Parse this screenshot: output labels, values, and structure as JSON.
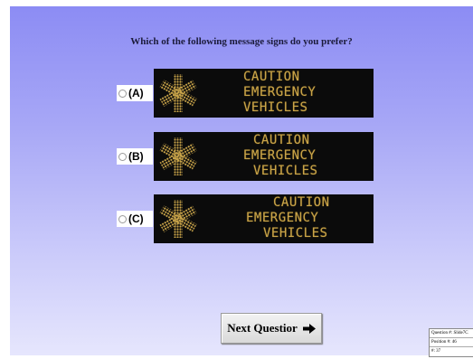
{
  "question": "Which of the following message signs do you prefer?",
  "options": [
    {
      "label": "(A)",
      "lines": [
        "CAUTION",
        "EMERGENCY",
        "VEHICLES"
      ]
    },
    {
      "label": "(B)",
      "lines": [
        "CAUTION",
        "EMERGENCY",
        "VEHICLES"
      ]
    },
    {
      "label": "(C)",
      "lines": [
        "CAUTION",
        "EMERGENCY",
        "VEHICLES"
      ]
    }
  ],
  "sign_text_color": "#c9a449",
  "sign_icon": "star-of-life-icon",
  "next_button": {
    "label": "Next Questior",
    "icon": "arrow-right-icon"
  },
  "info": {
    "question_no": "Question #: Slide7C",
    "position_no": "Position #: 46",
    "number": "#: 37"
  }
}
